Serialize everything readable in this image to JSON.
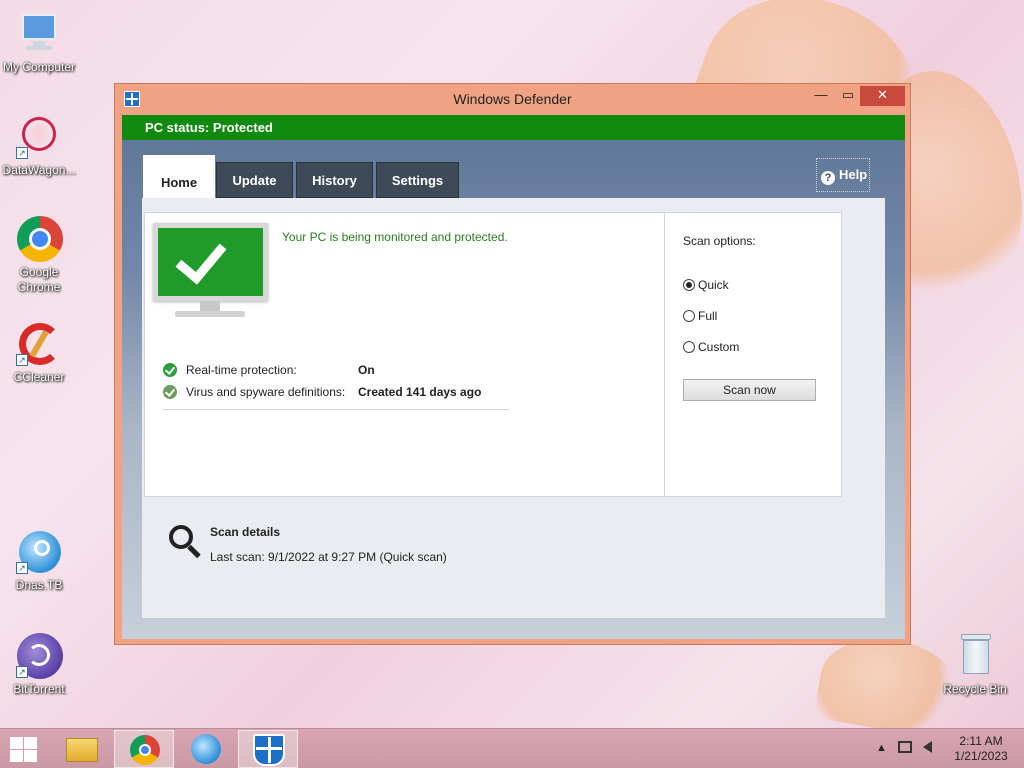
{
  "desktop": {
    "icons": [
      {
        "label": "My Computer"
      },
      {
        "label": "DataWagon..."
      },
      {
        "label": "Google Chrome"
      },
      {
        "label": "CCleaner"
      },
      {
        "label": "Dnas.TB"
      },
      {
        "label": "BitTorrent"
      },
      {
        "label": "Recycle Bin"
      }
    ]
  },
  "window": {
    "title": "Windows Defender",
    "controls": {
      "minimize": "—",
      "maximize": "▭",
      "close": "✕"
    },
    "status_bar": "PC status: Protected",
    "tabs": [
      {
        "label": "Home",
        "active": true
      },
      {
        "label": "Update",
        "active": false
      },
      {
        "label": "History",
        "active": false
      },
      {
        "label": "Settings",
        "active": false
      }
    ],
    "help": {
      "label": "Help",
      "arrow": "▾"
    },
    "home": {
      "message": "Your PC is being monitored and protected.",
      "status_items": [
        {
          "label": "Real-time protection:",
          "value": "On",
          "icon": "check-circle-icon"
        },
        {
          "label": "Virus and spyware definitions:",
          "value": "Created 141 days ago",
          "icon": "refresh-check-icon"
        }
      ],
      "scan_options": {
        "label": "Scan options:",
        "options": [
          {
            "label": "Quick",
            "selected": true
          },
          {
            "label": "Full",
            "selected": false
          },
          {
            "label": "Custom",
            "selected": false
          }
        ],
        "scan_now_label": "Scan now"
      },
      "scan_details": {
        "title": "Scan details",
        "last_scan": "Last scan:  9/1/2022 at 9:27 PM (Quick scan)"
      }
    }
  },
  "taskbar": {
    "clock_time": "2:11 AM",
    "clock_date": "1/21/2023",
    "tray_arrow": "▲"
  },
  "colors": {
    "status_green": "#108a0e",
    "tab_dark": "#3f4a58",
    "window_frame": "#f0a283",
    "close_red": "#c74a3a"
  }
}
